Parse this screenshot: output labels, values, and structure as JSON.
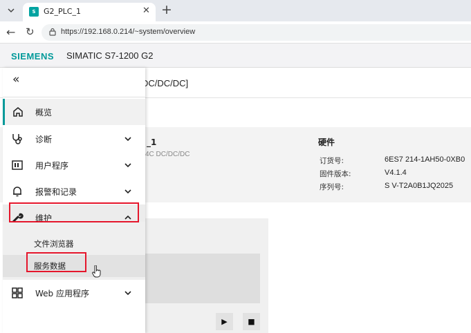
{
  "browser": {
    "tab_title": "G2_PLC_1",
    "favicon_text": "S",
    "url": "https://192.168.0.214/~system/overview"
  },
  "app": {
    "brand": "SIEMENS",
    "product": "SIMATIC S7-1200 G2"
  },
  "device": {
    "name_suffix": "DC/DC/DC]",
    "cpu_title_partial": "_1",
    "cpu_sub_partial": "4C DC/DC/DC"
  },
  "hardware": {
    "title": "硬件",
    "rows": [
      {
        "label": "订货号:",
        "value": "6ES7 214-1AH50-0XB0"
      },
      {
        "label": "固件版本:",
        "value": "V4.1.4"
      },
      {
        "label": "序列号:",
        "value": "S V-T2A0B1JQ2025"
      }
    ]
  },
  "controls": {
    "play": "▶",
    "stop": "■"
  },
  "sidebar": {
    "collapse": "«",
    "items": [
      {
        "label": "概览"
      },
      {
        "label": "诊断"
      },
      {
        "label": "用户程序"
      },
      {
        "label": "报警和记录"
      },
      {
        "label": "维护"
      },
      {
        "label": "Web 应用程序"
      }
    ],
    "maintenance_children": [
      {
        "label": "文件浏览器"
      },
      {
        "label": "服务数据"
      }
    ]
  },
  "colors": {
    "accent": "#009999",
    "highlight": "#e5152b"
  }
}
